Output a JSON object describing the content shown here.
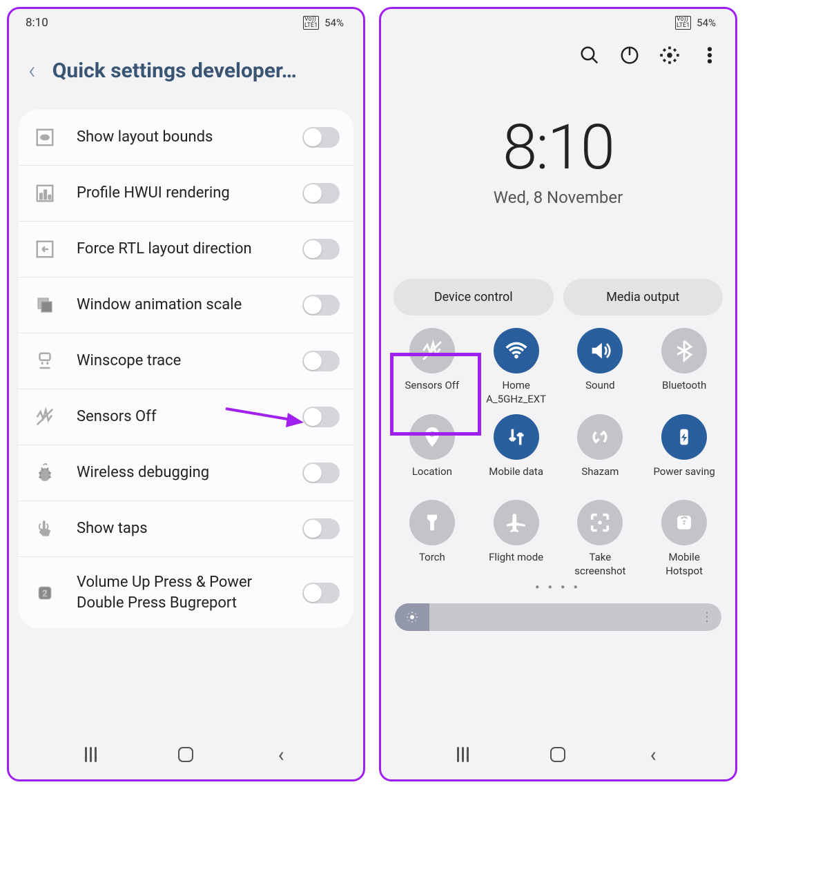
{
  "left_phone": {
    "status": {
      "time": "8:10",
      "battery": "54%"
    },
    "header": {
      "title": "Quick settings developer…"
    },
    "settings": [
      {
        "label": "Show layout bounds"
      },
      {
        "label": "Profile HWUI rendering"
      },
      {
        "label": "Force RTL layout direction"
      },
      {
        "label": "Window animation scale"
      },
      {
        "label": "Winscope trace"
      },
      {
        "label": "Sensors Off"
      },
      {
        "label": "Wireless debugging"
      },
      {
        "label": "Show taps"
      },
      {
        "label": "Volume Up Press & Power Double Press Bugreport"
      }
    ]
  },
  "right_phone": {
    "status": {
      "battery": "54%"
    },
    "clock": {
      "time": "8:10",
      "date": "Wed, 8 November"
    },
    "pills": {
      "device_control": "Device control",
      "media_output": "Media output"
    },
    "tiles": [
      {
        "label": "Sensors Off",
        "active": false
      },
      {
        "label": "Home A_5GHz_EXT",
        "active": true
      },
      {
        "label": "Sound",
        "active": true
      },
      {
        "label": "Bluetooth",
        "active": false
      },
      {
        "label": "Location",
        "active": false
      },
      {
        "label": "Mobile data",
        "active": true
      },
      {
        "label": "Shazam",
        "active": false
      },
      {
        "label": "Power saving",
        "active": true
      },
      {
        "label": "Torch",
        "active": false
      },
      {
        "label": "Flight mode",
        "active": false
      },
      {
        "label": "Take screenshot",
        "active": false
      },
      {
        "label": "Mobile Hotspot",
        "active": false
      }
    ]
  }
}
